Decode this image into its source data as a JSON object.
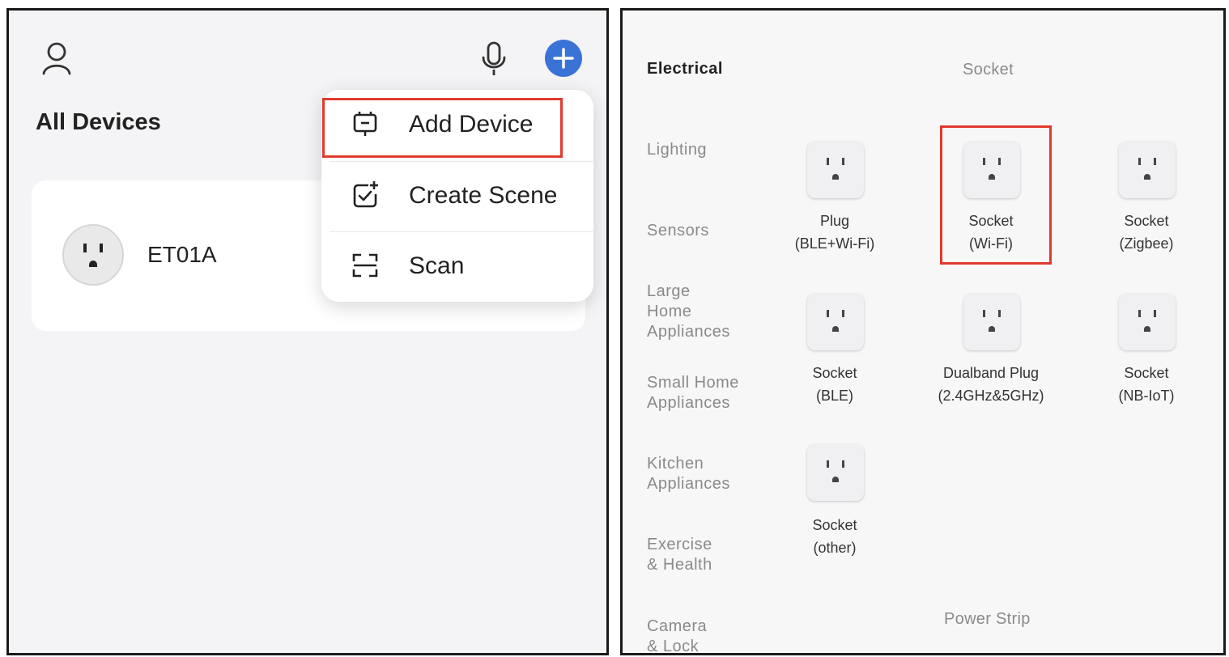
{
  "left": {
    "title": "All Devices",
    "devices": [
      {
        "name": "ET01A",
        "icon": "socket-icon"
      }
    ],
    "menu": {
      "items": [
        {
          "label": "Add Device",
          "icon": "add-device-icon"
        },
        {
          "label": "Create Scene",
          "icon": "create-scene-icon"
        },
        {
          "label": "Scan",
          "icon": "scan-icon"
        }
      ]
    },
    "header_icons": [
      "user-icon",
      "microphone-icon",
      "plus-icon"
    ],
    "accent_color": "#3a73d6",
    "highlight_color": "#e03a2f"
  },
  "right": {
    "categories": [
      {
        "label": "Electrical",
        "active": true
      },
      {
        "label": "Lighting"
      },
      {
        "label": "Sensors"
      },
      {
        "label": "Large\nHome\nAppliances"
      },
      {
        "label": "Small Home\nAppliances"
      },
      {
        "label": "Kitchen\nAppliances"
      },
      {
        "label": "Exercise\n& Health"
      },
      {
        "label": "Camera\n& Lock"
      }
    ],
    "section_socket": "Socket",
    "section_power_strip": "Power Strip",
    "products": [
      {
        "name": "Plug",
        "sub": "(BLE+Wi-Fi)"
      },
      {
        "name": "Socket",
        "sub": "(Wi-Fi)"
      },
      {
        "name": "Socket",
        "sub": "(Zigbee)"
      },
      {
        "name": "Socket",
        "sub": "(BLE)"
      },
      {
        "name": "Dualband Plug",
        "sub": "(2.4GHz&5GHz)"
      },
      {
        "name": "Socket",
        "sub": "(NB-IoT)"
      },
      {
        "name": "Socket",
        "sub": "(other)"
      }
    ]
  }
}
